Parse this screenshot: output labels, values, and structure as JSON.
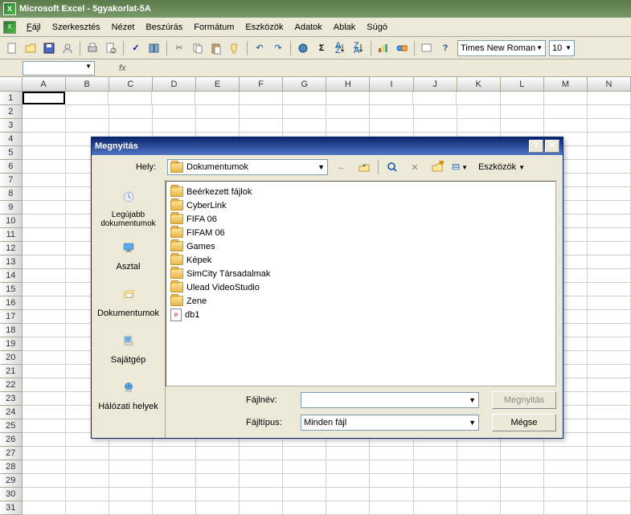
{
  "app": {
    "title": "Microsoft Excel - 5gyakorlat-5A"
  },
  "menu": {
    "file": "Fájl",
    "edit": "Szerkesztés",
    "view": "Nézet",
    "insert": "Beszúrás",
    "format": "Formátum",
    "tools": "Eszközök",
    "data": "Adatok",
    "window": "Ablak",
    "help": "Súgó"
  },
  "toolbar": {
    "font": "Times New Roman",
    "size": "10"
  },
  "formula": {
    "cell_ref": "",
    "fx": "fx"
  },
  "columns": [
    "A",
    "B",
    "C",
    "D",
    "E",
    "F",
    "G",
    "H",
    "I",
    "J",
    "K",
    "L",
    "M",
    "N"
  ],
  "rows": [
    "1",
    "2",
    "3",
    "4",
    "5",
    "6",
    "7",
    "8",
    "9",
    "10",
    "11",
    "12",
    "13",
    "14",
    "15",
    "16",
    "17",
    "18",
    "19",
    "20",
    "21",
    "22",
    "23",
    "24",
    "25",
    "26",
    "27",
    "28",
    "29",
    "30",
    "31"
  ],
  "dialog": {
    "title": "Megnyitás",
    "help": "?",
    "close": "✕",
    "lookin_label": "Hely:",
    "lookin_value": "Dokumentumok",
    "tools_label": "Eszközök",
    "places": {
      "recent": "Legújabb dokumentumok",
      "desktop": "Asztal",
      "mydocs": "Dokumentumok",
      "mycomp": "Sajátgép",
      "network": "Hálózati helyek"
    },
    "files": [
      {
        "name": "Beérkezett fájlok",
        "type": "folder"
      },
      {
        "name": "CyberLink",
        "type": "folder"
      },
      {
        "name": "FIFA 06",
        "type": "folder"
      },
      {
        "name": "FIFAM 06",
        "type": "folder"
      },
      {
        "name": "Games",
        "type": "folder"
      },
      {
        "name": "Képek",
        "type": "folder"
      },
      {
        "name": "SimCity Társadalmak",
        "type": "folder"
      },
      {
        "name": "Ulead VideoStudio",
        "type": "folder"
      },
      {
        "name": "Zene",
        "type": "folder"
      },
      {
        "name": "db1",
        "type": "html"
      }
    ],
    "filename_label": "Fájlnév:",
    "filetype_label": "Fájltípus:",
    "filetype_value": "Minden fájl",
    "open_btn": "Megnyitás",
    "cancel_btn": "Mégse"
  }
}
